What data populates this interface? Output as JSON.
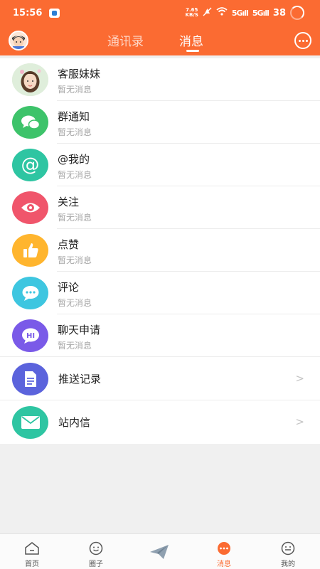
{
  "status_bar": {
    "time": "15:56",
    "speed_top": "7.65",
    "speed_bottom": "KB/S",
    "net1": "5Gıll",
    "net2": "5Gıll",
    "battery": "38"
  },
  "header": {
    "tabs": [
      {
        "label": "通讯录"
      },
      {
        "label": "消息"
      }
    ]
  },
  "rows": [
    {
      "title": "客服妹妹",
      "subtitle": "暂无消息",
      "icon": "customer-service-avatar",
      "color": "#d9e8d2"
    },
    {
      "title": "群通知",
      "subtitle": "暂无消息",
      "icon": "chat-bubbles-icon",
      "color": "#3dc36a"
    },
    {
      "title": "@我的",
      "subtitle": "暂无消息",
      "icon": "at-icon",
      "color": "#2ec5a2"
    },
    {
      "title": "关注",
      "subtitle": "暂无消息",
      "icon": "eye-icon",
      "color": "#f0556b"
    },
    {
      "title": "点赞",
      "subtitle": "暂无消息",
      "icon": "thumbs-up-icon",
      "color": "#ffb52e"
    },
    {
      "title": "评论",
      "subtitle": "暂无消息",
      "icon": "comment-icon",
      "color": "#3ec6e0"
    },
    {
      "title": "聊天申请",
      "subtitle": "暂无消息",
      "icon": "hi-bubble-icon",
      "color": "#7a5ae8"
    },
    {
      "title": "推送记录",
      "chevron": ">",
      "icon": "document-icon",
      "color": "#5b63dc"
    },
    {
      "title": "站内信",
      "chevron": ">",
      "icon": "envelope-icon",
      "color": "#2ec5a2"
    }
  ],
  "bottom_nav": [
    {
      "label": "首页",
      "icon": "home-icon"
    },
    {
      "label": "圈子",
      "icon": "circle-face-icon"
    },
    {
      "label": "",
      "icon": "paper-plane-icon"
    },
    {
      "label": "消息",
      "icon": "message-icon",
      "active": true
    },
    {
      "label": "我的",
      "icon": "profile-icon"
    }
  ],
  "colors": {
    "accent": "#fb6b32",
    "background": "#f0f0f0"
  }
}
